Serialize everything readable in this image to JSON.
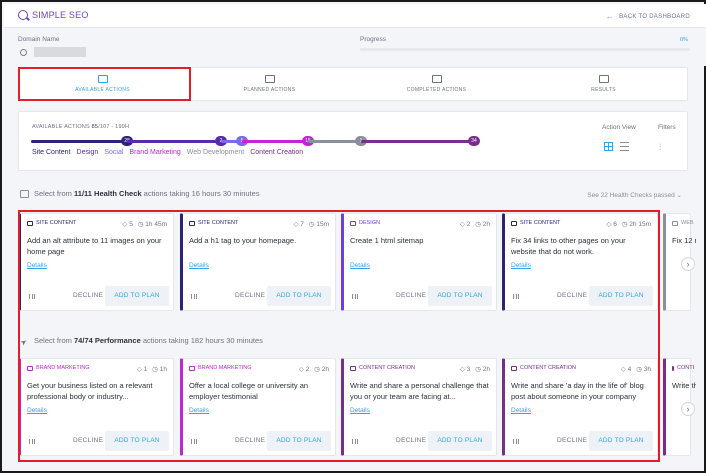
{
  "app": {
    "title": "SIMPLE SEO",
    "back_label": "BACK TO DASHBOARD"
  },
  "info": {
    "domain_label": "Domain Name",
    "progress_label": "Progress",
    "progress_value": "0%"
  },
  "tabs": [
    {
      "label": "AVAILABLE ACTIONS",
      "active": true
    },
    {
      "label": "PLANNED ACTIONS",
      "active": false
    },
    {
      "label": "COMPLETED ACTIONS",
      "active": false
    },
    {
      "label": "RESULTS",
      "active": false
    }
  ],
  "summary": {
    "available_prefix": "AVAILABLE ACTIONS",
    "available_count": "85",
    "available_suffix": "/107 - 199H",
    "action_view_label": "Action View",
    "filters_label": "Filters",
    "track": [
      {
        "count": "28",
        "color": "#2c2378"
      },
      {
        "count": "2",
        "color": "#5b2aa8"
      },
      {
        "count": "5",
        "color": "#7b68ee"
      },
      {
        "count": "15",
        "color": "#c026d3"
      },
      {
        "count": "1",
        "color": "#8a8f99"
      },
      {
        "count": "34",
        "color": "#7b2d8e"
      }
    ],
    "categories": [
      {
        "label": "Site Content",
        "color": "#2c2378"
      },
      {
        "label": "Design",
        "color": "#5b2aa8"
      },
      {
        "label": "Social",
        "color": "#7b68ee"
      },
      {
        "label": "Brand Marketing",
        "color": "#c026d3"
      },
      {
        "label": "Web Development",
        "color": "#8a8f99"
      },
      {
        "label": "Content Creation",
        "color": "#7b2d8e"
      }
    ]
  },
  "health": {
    "prefix": "Select from ",
    "count": "11",
    "of": "/11",
    "name": " Health Check",
    "suffix": " actions taking 16 hours 30 minutes",
    "see_passed": "See 22 Health Checks passed"
  },
  "performance": {
    "prefix": "Select from ",
    "count": "74",
    "of": "/74",
    "name": " Performance",
    "suffix": " actions taking 182 hours 30 minutes"
  },
  "labels": {
    "details": "Details",
    "decline": "DECLINE",
    "add": "ADD TO PLAN"
  },
  "health_cards": [
    {
      "category": "SITE CONTENT",
      "color": "#2c2378",
      "points": "5",
      "time": "1h 45m",
      "title": "Add an alt attribute to 11 images on your home page"
    },
    {
      "category": "SITE CONTENT",
      "color": "#2c2378",
      "points": "7",
      "time": "15m",
      "title": "Add a h1 tag to your homepage."
    },
    {
      "category": "DESIGN",
      "color": "#6d3fd6",
      "points": "2",
      "time": "2h",
      "title": "Create 1 html sitemap"
    },
    {
      "category": "SITE CONTENT",
      "color": "#2c2378",
      "points": "6",
      "time": "2h 15m",
      "title": "Fix 34 links to other pages on your website that do not work."
    },
    {
      "category": "WEB",
      "color": "#8a8f99",
      "points": "",
      "time": "",
      "title": "Fix 12 respo"
    }
  ],
  "performance_cards": [
    {
      "category": "BRAND MARKETING",
      "color": "#c026d3",
      "points": "1",
      "time": "1h",
      "title": "Get your business listed on a relevant professional body or industry..."
    },
    {
      "category": "BRAND MARKETING",
      "color": "#c026d3",
      "points": "2",
      "time": "2h",
      "title": "Offer a local college or university an employer testimonial"
    },
    {
      "category": "CONTENT CREATION",
      "color": "#7b2d8e",
      "points": "3",
      "time": "2h",
      "title": "Write and share a personal challenge that you or your team are facing at..."
    },
    {
      "category": "CONTENT CREATION",
      "color": "#7b2d8e",
      "points": "4",
      "time": "3h",
      "title": "Write and share 'a day in the life of' blog post about someone in your company"
    },
    {
      "category": "CONTE",
      "color": "#7b2d8e",
      "points": "",
      "time": "",
      "title": "Write the t"
    }
  ]
}
